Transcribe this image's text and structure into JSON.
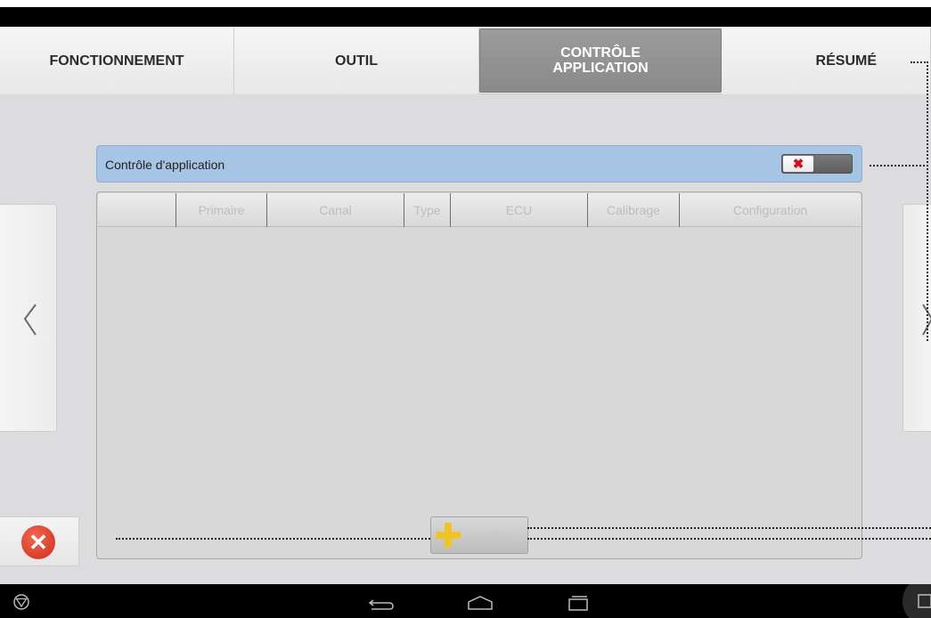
{
  "tabs": [
    {
      "label": "FONCTIONNEMENT",
      "active": false
    },
    {
      "label": "OUTIL",
      "active": false
    },
    {
      "label": "CONTRÔLE\nAPPLICATION",
      "active": true
    },
    {
      "label": "RÉSUMÉ",
      "active": false
    }
  ],
  "section": {
    "title": "Contrôle d'application",
    "toggle_state": "off",
    "toggle_symbol": "✖"
  },
  "table": {
    "columns": [
      "",
      "Primaire",
      "Canal",
      "Type",
      "ECU",
      "Calibrage",
      "Configuration"
    ],
    "rows": []
  },
  "add_button": {
    "label": "AJOUTER"
  },
  "nav": {
    "prev_symbol": "〈",
    "next_symbol": "〉"
  },
  "cancel_button": {
    "symbol": "✕"
  },
  "colors": {
    "accent_header": "#a6c4e4",
    "active_tab": "#8f8f8f",
    "add_icon": "#f2c324",
    "cancel": "#d9381f"
  },
  "icons": [
    "chevron-left-icon",
    "chevron-right-icon",
    "toggle-x-icon",
    "plus-icon",
    "cancel-icon",
    "back-icon",
    "home-icon",
    "recents-icon",
    "logo-icon",
    "camera-icon"
  ]
}
